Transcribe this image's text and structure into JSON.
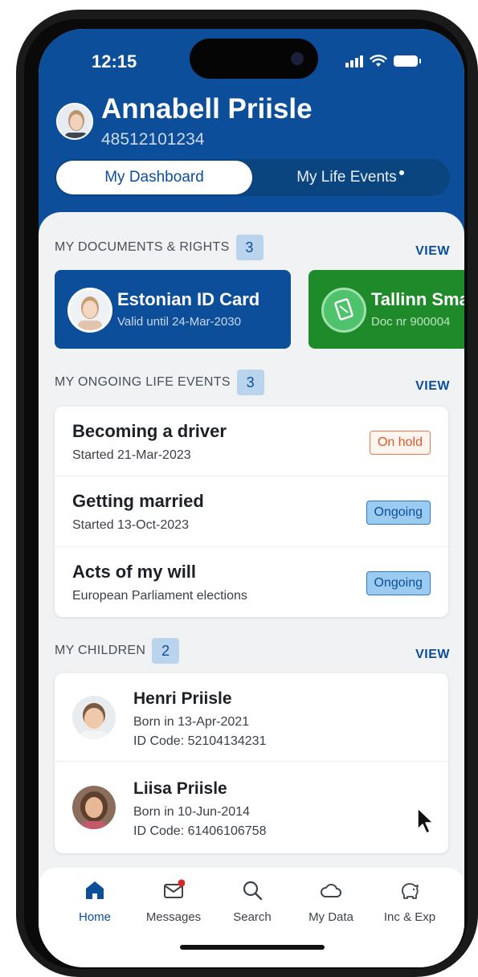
{
  "status_bar": {
    "time": "12:15"
  },
  "profile": {
    "name": "Annabell Priisle",
    "id_number": "48512101234"
  },
  "tabs": [
    {
      "label": "My Dashboard",
      "active": true
    },
    {
      "label": "My Life Events",
      "has_dot": true,
      "active": false
    }
  ],
  "documents": {
    "title": "MY DOCUMENTS & RIGHTS",
    "count": "3",
    "view": "VIEW",
    "items": [
      {
        "title": "Estonian ID Card",
        "subtitle": "Valid until 24-Mar-2030",
        "color": "#0c4e9a"
      },
      {
        "title": "Tallinn Sma",
        "subtitle": "Doc nr 900004",
        "color": "#1f8a29"
      }
    ]
  },
  "life_events": {
    "title": "MY ONGOING LIFE EVENTS",
    "count": "3",
    "view": "VIEW",
    "items": [
      {
        "title": "Becoming a driver",
        "subtitle": "Started 21-Mar-2023",
        "status": "On hold"
      },
      {
        "title": "Getting married",
        "subtitle": "Started 13-Oct-2023",
        "status": "Ongoing"
      },
      {
        "title": "Acts of my will",
        "subtitle": "European Parliament elections",
        "status": "Ongoing"
      }
    ]
  },
  "children": {
    "title": "MY CHILDREN",
    "count": "2",
    "view": "VIEW",
    "items": [
      {
        "name": "Henri Priisle",
        "born": "Born in 13-Apr-2021",
        "id_code": "ID Code: 52104134231"
      },
      {
        "name": "Liisa Priisle",
        "born": "Born in 10-Jun-2014",
        "id_code": "ID Code: 61406106758"
      }
    ]
  },
  "bottom_nav": [
    {
      "label": "Home",
      "icon": "home-icon",
      "active": true
    },
    {
      "label": "Messages",
      "icon": "messages-icon",
      "badge": true
    },
    {
      "label": "Search",
      "icon": "search-icon"
    },
    {
      "label": "My Data",
      "icon": "cloud-icon"
    },
    {
      "label": "Inc & Exp",
      "icon": "piggy-bank-icon"
    }
  ],
  "colors": {
    "primary": "#0c4e9a",
    "green": "#1f8a29",
    "on_hold": "#d85a25",
    "ongoing_bg": "#9ccbf1",
    "badge_bg": "#b9d4ec",
    "notification_dot": "#d42a2a"
  }
}
